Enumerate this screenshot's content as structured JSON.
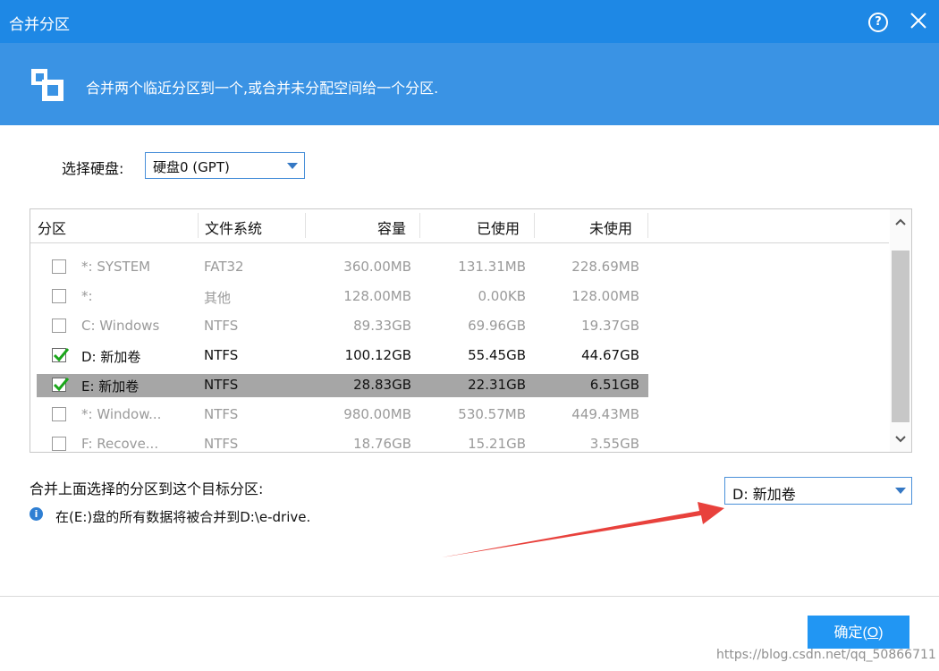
{
  "window": {
    "title": "合并分区",
    "help_icon": "?"
  },
  "banner": {
    "icon": "merge-partitions-icon",
    "text": "合并两个临近分区到一个,或合并未分配空间给一个分区."
  },
  "disk_selector": {
    "label": "选择硬盘:",
    "value": "硬盘0 (GPT)"
  },
  "table": {
    "columns": [
      "分区",
      "文件系统",
      "容量",
      "已使用",
      "未使用"
    ],
    "rows": [
      {
        "name": "*: SYSTEM",
        "fs": "FAT32",
        "capacity": "360.00MB",
        "used": "131.31MB",
        "free": "228.69MB",
        "checked": false,
        "enabled": false,
        "selected": false
      },
      {
        "name": "*:",
        "fs": "其他",
        "capacity": "128.00MB",
        "used": "0.00KB",
        "free": "128.00MB",
        "checked": false,
        "enabled": false,
        "selected": false
      },
      {
        "name": "C: Windows",
        "fs": "NTFS",
        "capacity": "89.33GB",
        "used": "69.96GB",
        "free": "19.37GB",
        "checked": false,
        "enabled": false,
        "selected": false
      },
      {
        "name": "D: 新加卷",
        "fs": "NTFS",
        "capacity": "100.12GB",
        "used": "55.45GB",
        "free": "44.67GB",
        "checked": true,
        "enabled": true,
        "selected": false
      },
      {
        "name": "E: 新加卷",
        "fs": "NTFS",
        "capacity": "28.83GB",
        "used": "22.31GB",
        "free": "6.51GB",
        "checked": true,
        "enabled": true,
        "selected": true
      },
      {
        "name": "*: Window...",
        "fs": "NTFS",
        "capacity": "980.00MB",
        "used": "530.57MB",
        "free": "449.43MB",
        "checked": false,
        "enabled": false,
        "selected": false
      },
      {
        "name": "F: Recove...",
        "fs": "NTFS",
        "capacity": "18.76GB",
        "used": "15.21GB",
        "free": "3.55GB",
        "checked": false,
        "enabled": false,
        "selected": false
      }
    ]
  },
  "merge": {
    "label": "合并上面选择的分区到这个目标分区:",
    "target_value": "D: 新加卷",
    "info_text": "在(E:)盘的所有数据将被合并到D:\\e-drive."
  },
  "buttons": {
    "ok_label": "确定(",
    "ok_mnemonic": "O",
    "ok_suffix": ")"
  },
  "watermark": "https://blog.csdn.net/qq_50866711",
  "colors": {
    "titlebar": "#1e88e5",
    "banner": "#3a93e4",
    "ok_button": "#2196f3",
    "selected_row": "#a6a6a6",
    "annotation_arrow": "#e8413c"
  }
}
